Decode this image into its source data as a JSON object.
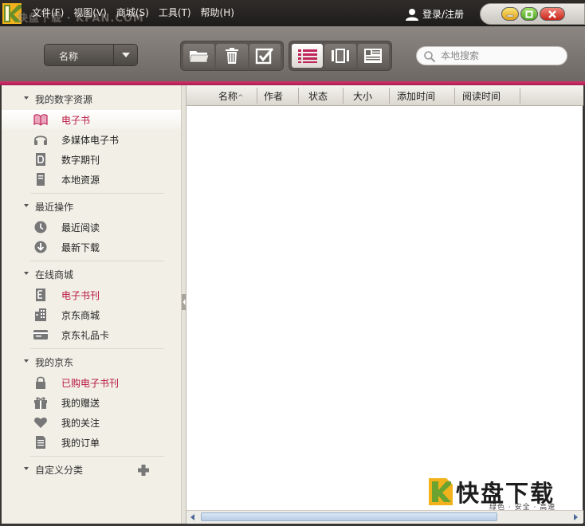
{
  "titlebar": {
    "watermark": "快盘下载 · KPAN.COM",
    "menus": [
      "文件(F)",
      "视图(V)",
      "商城(S)",
      "工具(T)",
      "帮助(H)"
    ],
    "login_label": "登录/注册"
  },
  "toolbar": {
    "sort_value": "名称",
    "search_placeholder": "本地搜索"
  },
  "sidebar": {
    "sections": [
      {
        "label": "我的数字资源",
        "items": [
          {
            "label": "电子书",
            "icon": "book-icon"
          },
          {
            "label": "多媒体电子书",
            "icon": "headphones-icon"
          },
          {
            "label": "数字期刊",
            "icon": "magazine-icon"
          },
          {
            "label": "本地资源",
            "icon": "local-file-icon"
          }
        ]
      },
      {
        "label": "最近操作",
        "items": [
          {
            "label": "最近阅读",
            "icon": "clock-icon"
          },
          {
            "label": "最新下载",
            "icon": "download-icon"
          }
        ]
      },
      {
        "label": "在线商城",
        "items": [
          {
            "label": "电子书刊",
            "icon": "ebook-store-icon"
          },
          {
            "label": "京东商城",
            "icon": "building-icon"
          },
          {
            "label": "京东礼品卡",
            "icon": "gift-card-icon"
          }
        ]
      },
      {
        "label": "我的京东",
        "items": [
          {
            "label": "已购电子书刊",
            "icon": "lock-icon"
          },
          {
            "label": "我的赠送",
            "icon": "gift-icon"
          },
          {
            "label": "我的关注",
            "icon": "heart-icon"
          },
          {
            "label": "我的订单",
            "icon": "order-icon"
          }
        ]
      },
      {
        "label": "自定义分类",
        "items": []
      }
    ]
  },
  "list": {
    "columns": [
      "名称",
      "作者",
      "状态",
      "大小",
      "添加时间",
      "阅读时间"
    ]
  },
  "brand": {
    "name": "快盘下载",
    "tagline": "绿色 · 安全 · 高速"
  },
  "colors": {
    "accent": "#c0245a",
    "selected_text": "#b8163f",
    "sidebar_bg": "#f1efe6"
  }
}
